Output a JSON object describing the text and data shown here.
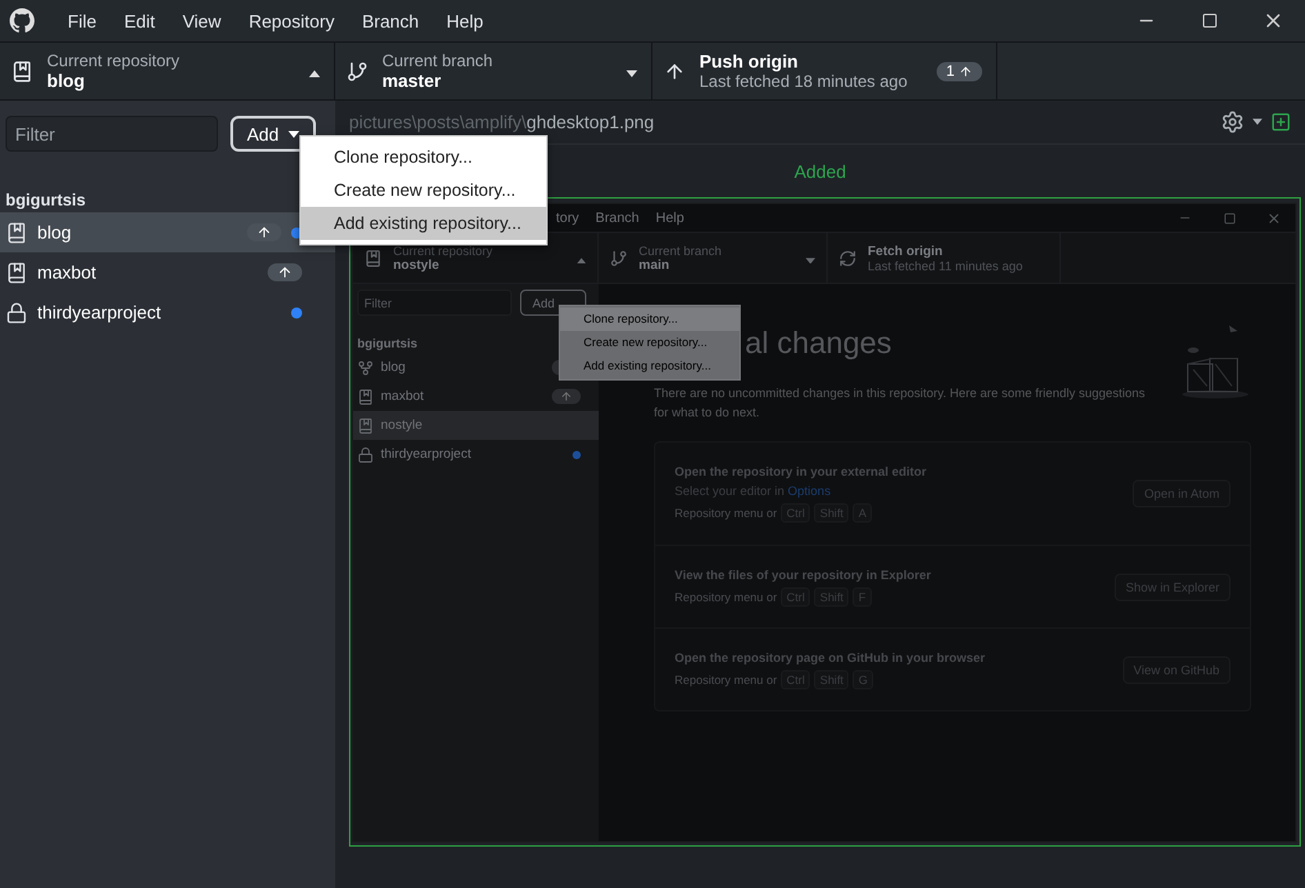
{
  "menu_bar": [
    "File",
    "Edit",
    "View",
    "Repository",
    "Branch",
    "Help"
  ],
  "toolbar": {
    "repository": {
      "label": "Current repository",
      "name": "blog",
      "expanded": true
    },
    "branch": {
      "label": "Current branch",
      "name": "master",
      "expanded": false
    },
    "push": {
      "title": "Push origin",
      "subtitle": "Last fetched 18 minutes ago",
      "count": "1"
    }
  },
  "sidebar": {
    "filter_placeholder": "Filter",
    "add_button": "Add",
    "groups": [
      {
        "owner": "bgigurtsis",
        "repositories": [
          {
            "name": "blog",
            "kind": "repo",
            "selected": true,
            "ahead": true,
            "changed": true
          },
          {
            "name": "maxbot",
            "kind": "repo",
            "selected": false,
            "ahead": true,
            "changed": false
          },
          {
            "name": "thirdyearproject",
            "kind": "private",
            "selected": false,
            "ahead": false,
            "changed": true
          }
        ]
      }
    ]
  },
  "add_menu": [
    {
      "label": "Clone repository...",
      "selected": false
    },
    {
      "label": "Create new repository...",
      "selected": false
    },
    {
      "label": "Add existing repository...",
      "selected": true
    }
  ],
  "diff": {
    "path": "pictures\\posts\\amplify\\",
    "file": "ghdesktop1.png",
    "status": "Added"
  },
  "screenshot": {
    "menu_bar": [
      "tory",
      "Branch",
      "Help"
    ],
    "toolbar": {
      "repository": {
        "label": "Current repository",
        "name": "nostyle",
        "expanded": true
      },
      "branch": {
        "label": "Current branch",
        "name": "main",
        "expanded": false
      },
      "fetch": {
        "title": "Fetch origin",
        "subtitle": "Last fetched 11 minutes ago"
      }
    },
    "filter_placeholder": "Filter",
    "add_button": "Add",
    "add_menu": [
      {
        "label": "Clone repository...",
        "selected": true
      },
      {
        "label": "Create new repository...",
        "selected": false
      },
      {
        "label": "Add existing repository...",
        "selected": false
      }
    ],
    "owner": "bgigurtsis",
    "repositories": [
      {
        "name": "blog",
        "kind": "fork",
        "selected": false,
        "ahead": true,
        "changed": false
      },
      {
        "name": "maxbot",
        "kind": "repo",
        "selected": false,
        "ahead": true,
        "changed": false
      },
      {
        "name": "nostyle",
        "kind": "repo",
        "selected": true,
        "ahead": false,
        "changed": false
      },
      {
        "name": "thirdyearproject",
        "kind": "private",
        "selected": false,
        "ahead": false,
        "changed": true
      }
    ],
    "heading": "al changes",
    "description": "There are no uncommitted changes in this repository. Here are some friendly suggestions for what to do next.",
    "suggestions": [
      {
        "title": "Open the repository in your external editor",
        "detail": "Select your editor in ",
        "link": "Options",
        "hint": "Repository menu or",
        "keys": [
          "Ctrl",
          "Shift",
          "A"
        ],
        "button": "Open in Atom"
      },
      {
        "title": "View the files of your repository in Explorer",
        "hint": "Repository menu or",
        "keys": [
          "Ctrl",
          "Shift",
          "F"
        ],
        "button": "Show in Explorer"
      },
      {
        "title": "Open the repository page on GitHub in your browser",
        "hint": "Repository menu or",
        "keys": [
          "Ctrl",
          "Shift",
          "G"
        ],
        "button": "View on GitHub"
      }
    ]
  }
}
